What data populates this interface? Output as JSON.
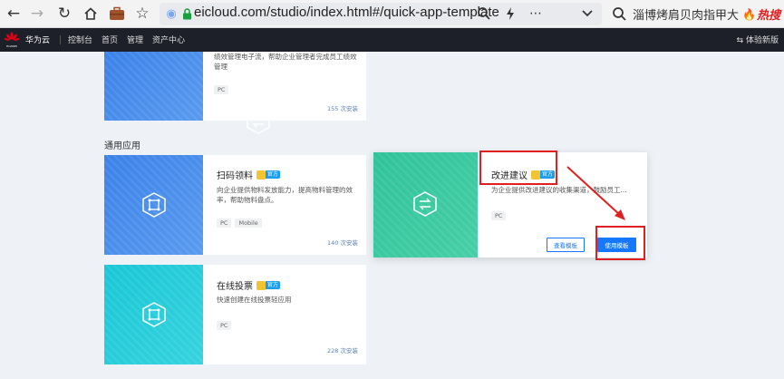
{
  "browser": {
    "url": "eicloud.com/studio/index.html#/quick-app-template",
    "hot_query": "淄博烤肩贝肉指甲大",
    "hot_tag": "热搜"
  },
  "header": {
    "brand": "华为云",
    "logo_text": "HUAWEI",
    "menu": [
      "控制台",
      "首页",
      "管理",
      "资产中心"
    ],
    "switch_label": "体验新版"
  },
  "section_title": "通用应用",
  "official_label": "官方",
  "cards": [
    {
      "title": "",
      "desc": "绩效管理电子流，帮助企业管理者完成员工绩效管理",
      "tags": [
        "PC"
      ],
      "installs": "155 次安装",
      "color": "#3b82e8",
      "official": false
    },
    {
      "title": "扫码领料",
      "desc": "向企业提供物料发放能力，提高物料管理的效率，帮助物料盘点。",
      "tags": [
        "PC",
        "Mobile"
      ],
      "installs": "140 次安装",
      "color": "#3b82e8",
      "official": true
    },
    {
      "title": "改进建议",
      "desc": "为企业提供改进建议的收集渠道，鼓励员工...",
      "tags": [
        "PC"
      ],
      "installs": "",
      "color": "#2fc39a",
      "official": true,
      "view_label": "查看模板",
      "use_label": "使用模板"
    },
    {
      "title": "在线投票",
      "desc": "快速创建在线投票轻应用",
      "tags": [
        "PC"
      ],
      "installs": "228 次安装",
      "color": "#19c7d6",
      "official": true
    }
  ],
  "highlight_color": "#e02020",
  "primary_color": "#1677ff"
}
